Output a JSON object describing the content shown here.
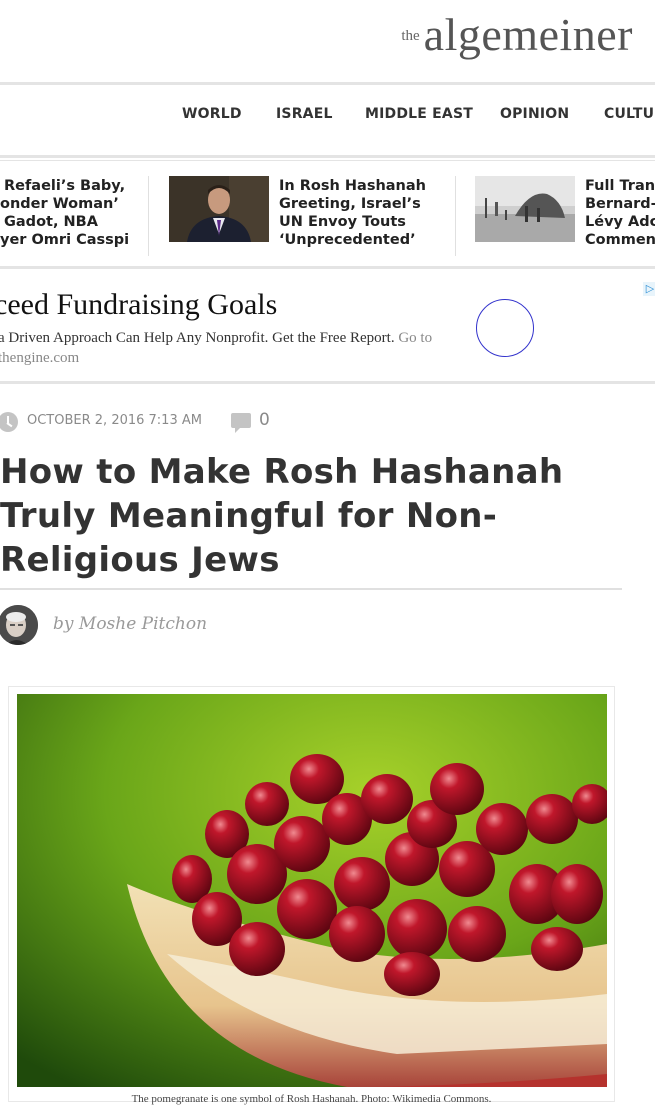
{
  "site": {
    "logo_prefix": "the",
    "logo_name": "algemeiner"
  },
  "nav": {
    "items": [
      "WORLD",
      "ISRAEL",
      "MIDDLE EAST",
      "OPINION",
      "CULTUR"
    ]
  },
  "stories": [
    {
      "lines": [
        "Refaeli’s Baby,",
        "onder Woman’",
        "Gadot, NBA",
        "yer Omri Casspi"
      ]
    },
    {
      "lines": [
        "In Rosh Hashanah",
        "Greeting, Israel’s",
        "UN Envoy Touts",
        "‘Unprecedented’"
      ]
    },
    {
      "lines": [
        "Full Tran",
        "Bernard-",
        "Lévy Adc",
        "Commen"
      ]
    }
  ],
  "ad": {
    "title": "ceed Fundraising Goals",
    "description": "a Driven Approach Can Help Any Nonprofit. Get the Free Report.",
    "link_text": "Go to",
    "link_domain": "thengine.com",
    "choices_icon": "adchoices-icon"
  },
  "article": {
    "date": "OCTOBER 2, 2016 7:13 AM",
    "comment_count": "0",
    "title": "How to Make Rosh Hashanah Truly Meaningful for Non-Religious Jews",
    "byline_prefix": "by",
    "author": "Moshe Pitchon",
    "image_caption": "The pomegranate is one symbol of Rosh Hashanah. Photo: Wikimedia Commons."
  },
  "colors": {
    "text_dark": "#333333",
    "meta_gray": "#8a8a8a",
    "rule_gray": "#e4e4e4",
    "ad_circle": "#3333cc",
    "pomegranate_red": "#8c0f1e",
    "background_green": "#7fb51e"
  }
}
